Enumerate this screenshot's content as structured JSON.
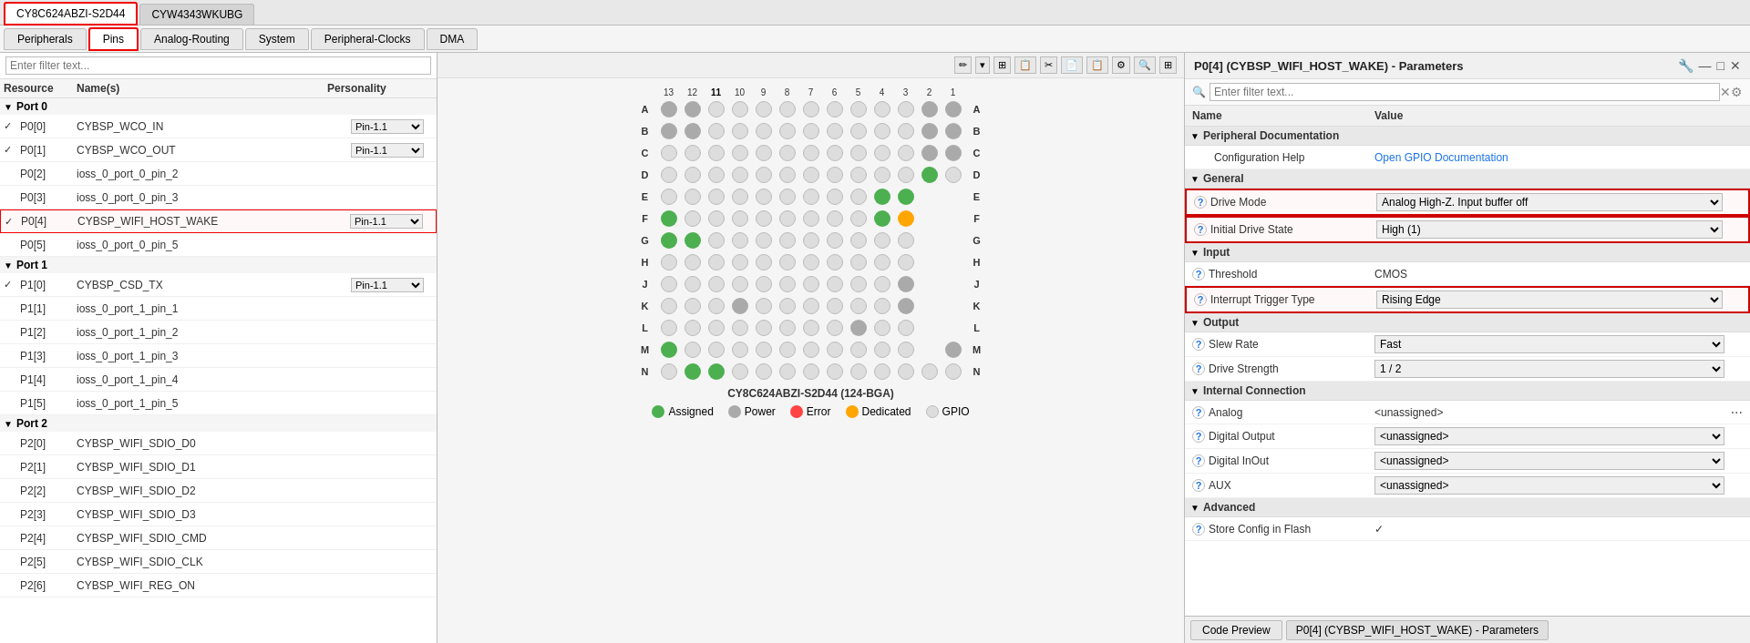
{
  "tabs": {
    "device_tabs": [
      {
        "label": "CY8C624ABZI-S2D44",
        "active": true
      },
      {
        "label": "CYW4343WKUBG",
        "active": false
      }
    ],
    "nav_tabs": [
      {
        "label": "Peripherals",
        "active": false
      },
      {
        "label": "Pins",
        "active": true,
        "red_border": true
      },
      {
        "label": "Analog-Routing",
        "active": false
      },
      {
        "label": "System",
        "active": false
      },
      {
        "label": "Peripheral-Clocks",
        "active": false
      },
      {
        "label": "DMA",
        "active": false
      }
    ]
  },
  "left_panel": {
    "filter_placeholder": "Enter filter text...",
    "col_resource": "Resource",
    "col_names": "Name(s)",
    "col_personality": "Personality",
    "ports": [
      {
        "label": "Port 0",
        "pins": [
          {
            "id": "P0[0]",
            "checked": true,
            "name": "CYBSP_WCO_IN",
            "personality": "Pin-1.1"
          },
          {
            "id": "P0[1]",
            "checked": true,
            "name": "CYBSP_WCO_OUT",
            "personality": "Pin-1.1"
          },
          {
            "id": "P0[2]",
            "checked": false,
            "name": "ioss_0_port_0_pin_2",
            "personality": ""
          },
          {
            "id": "P0[3]",
            "checked": false,
            "name": "ioss_0_port_0_pin_3",
            "personality": ""
          },
          {
            "id": "P0[4]",
            "checked": true,
            "name": "CYBSP_WIFI_HOST_WAKE",
            "personality": "Pin-1.1",
            "highlighted": true
          },
          {
            "id": "P0[5]",
            "checked": false,
            "name": "ioss_0_port_0_pin_5",
            "personality": ""
          }
        ]
      },
      {
        "label": "Port 1",
        "pins": [
          {
            "id": "P1[0]",
            "checked": true,
            "name": "CYBSP_CSD_TX",
            "personality": "Pin-1.1"
          },
          {
            "id": "P1[1]",
            "checked": false,
            "name": "ioss_0_port_1_pin_1",
            "personality": ""
          },
          {
            "id": "P1[2]",
            "checked": false,
            "name": "ioss_0_port_1_pin_2",
            "personality": ""
          },
          {
            "id": "P1[3]",
            "checked": false,
            "name": "ioss_0_port_1_pin_3",
            "personality": ""
          },
          {
            "id": "P1[4]",
            "checked": false,
            "name": "ioss_0_port_1_pin_4",
            "personality": ""
          },
          {
            "id": "P1[5]",
            "checked": false,
            "name": "ioss_0_port_1_pin_5",
            "personality": ""
          }
        ]
      },
      {
        "label": "Port 2",
        "pins": [
          {
            "id": "P2[0]",
            "checked": false,
            "name": "CYBSP_WIFI_SDIO_D0",
            "personality": ""
          },
          {
            "id": "P2[1]",
            "checked": false,
            "name": "CYBSP_WIFI_SDIO_D1",
            "personality": ""
          },
          {
            "id": "P2[2]",
            "checked": false,
            "name": "CYBSP_WIFI_SDIO_D2",
            "personality": ""
          },
          {
            "id": "P2[3]",
            "checked": false,
            "name": "CYBSP_WIFI_SDIO_D3",
            "personality": ""
          },
          {
            "id": "P2[4]",
            "checked": false,
            "name": "CYBSP_WIFI_SDIO_CMD",
            "personality": ""
          },
          {
            "id": "P2[5]",
            "checked": false,
            "name": "CYBSP_WIFI_SDIO_CLK",
            "personality": ""
          },
          {
            "id": "P2[6]",
            "checked": false,
            "name": "CYBSP_WIFI_REG_ON",
            "personality": ""
          }
        ]
      }
    ]
  },
  "chip": {
    "title": "CY8C624ABZI-S2D44 (124-BGA)",
    "legend": [
      {
        "label": "Assigned",
        "color": "#4CAF50"
      },
      {
        "label": "Power",
        "color": "#aaa"
      },
      {
        "label": "Error",
        "color": "#f44"
      },
      {
        "label": "Dedicated",
        "color": "#FFA500"
      },
      {
        "label": "GPIO",
        "color": "#ddd"
      }
    ],
    "col_labels": [
      "13",
      "12",
      "11",
      "10",
      "9",
      "8",
      "7",
      "6",
      "5",
      "4",
      "3",
      "2",
      "1"
    ],
    "row_labels": [
      "A",
      "B",
      "C",
      "D",
      "E",
      "F",
      "G",
      "H",
      "J",
      "K",
      "L",
      "M",
      "N"
    ]
  },
  "right_panel": {
    "title": "P0[4] (CYBSP_WIFI_HOST_WAKE) - Parameters",
    "filter_placeholder": "Enter filter text...",
    "col_name": "Name",
    "col_value": "Value",
    "sections": [
      {
        "label": "Peripheral Documentation",
        "rows": [
          {
            "name": "Configuration Help",
            "value_text": "Open GPIO Documentation",
            "value_link": true,
            "help": false
          }
        ]
      },
      {
        "label": "General",
        "rows": [
          {
            "name": "Drive Mode",
            "value_text": "Analog High-Z. Input buffer off",
            "value_select": true,
            "help": true,
            "highlighted": true
          },
          {
            "name": "Initial Drive State",
            "value_text": "High (1)",
            "value_select": true,
            "help": true,
            "highlighted": true
          }
        ]
      },
      {
        "label": "Input",
        "rows": [
          {
            "name": "Threshold",
            "value_text": "CMOS",
            "value_select": false,
            "help": true
          },
          {
            "name": "Interrupt Trigger Type",
            "value_text": "Rising Edge",
            "value_select": true,
            "help": true,
            "highlighted": true
          }
        ]
      },
      {
        "label": "Output",
        "rows": [
          {
            "name": "Slew Rate",
            "value_text": "Fast",
            "value_select": true,
            "help": true
          },
          {
            "name": "Drive Strength",
            "value_text": "1 / 2",
            "value_select": true,
            "help": true
          }
        ]
      },
      {
        "label": "Internal Connection",
        "rows": [
          {
            "name": "Analog",
            "value_text": "<unassigned>",
            "value_dots": true,
            "help": true
          },
          {
            "name": "Digital Output",
            "value_text": "<unassigned>",
            "value_select": true,
            "help": true
          },
          {
            "name": "Digital InOut",
            "value_text": "<unassigned>",
            "value_select": true,
            "help": true
          },
          {
            "name": "AUX",
            "value_text": "<unassigned>",
            "value_select": true,
            "help": true
          }
        ]
      },
      {
        "label": "Advanced",
        "rows": [
          {
            "name": "Store Config in Flash",
            "value_text": "✓",
            "value_select": false,
            "help": true
          }
        ]
      }
    ],
    "footer": {
      "code_preview": "Code Preview",
      "params_tab": "P0[4] (CYBSP_WIFI_HOST_WAKE) - Parameters"
    }
  }
}
